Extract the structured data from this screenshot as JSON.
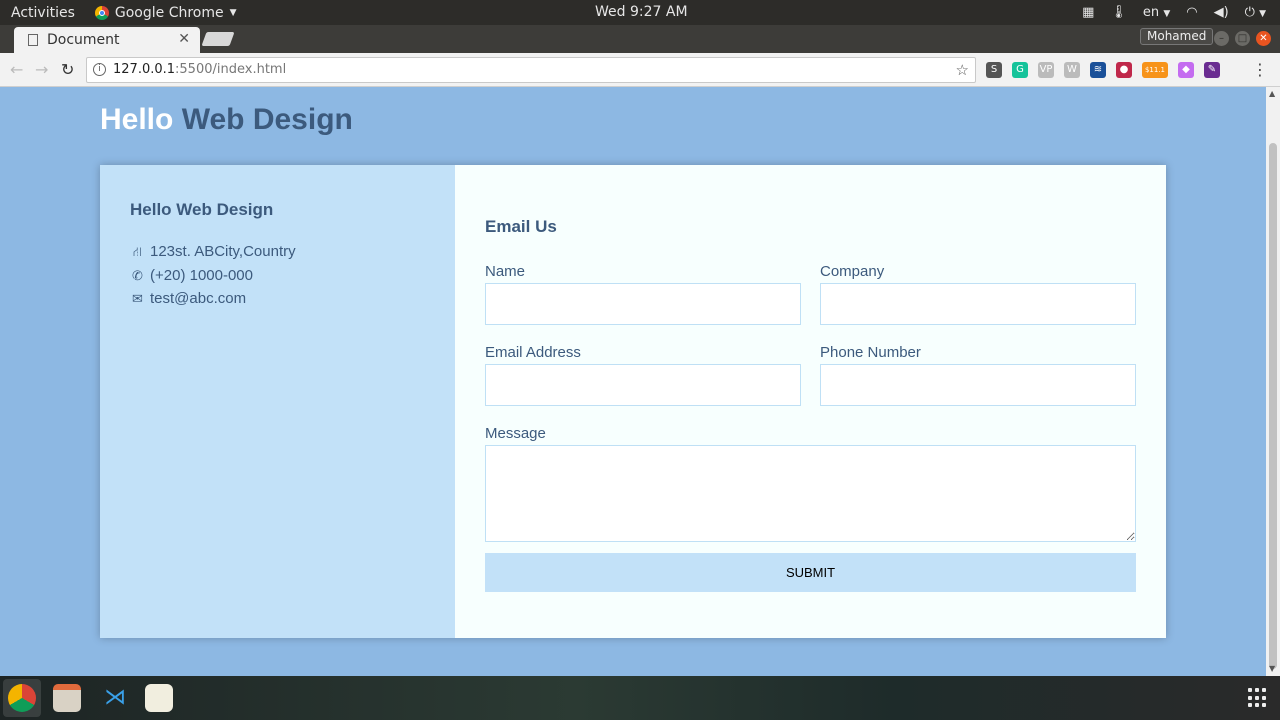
{
  "system": {
    "activities": "Activities",
    "app_menu": "Google Chrome",
    "clock": "Wed  9:27 AM",
    "language": "en"
  },
  "browser": {
    "tab_title": "Document",
    "profile_name": "Mohamed",
    "url_host": "127.0.0.1",
    "url_path": ":5500/index.html"
  },
  "extensions": [
    {
      "name": "s-extension-icon",
      "label": "S",
      "color": "#555555"
    },
    {
      "name": "grammarly-icon",
      "label": "G",
      "color": "#15c39a"
    },
    {
      "name": "vp-extension-icon",
      "label": "VP",
      "color": "#bbbbbb"
    },
    {
      "name": "wordpress-icon",
      "label": "W",
      "color": "#bbbbbb"
    },
    {
      "name": "steem-icon",
      "label": "≋",
      "color": "#1a5099"
    },
    {
      "name": "colorful-circle-icon",
      "label": "●",
      "color": "#c0284b"
    },
    {
      "name": "bitcoin-price-icon",
      "label": "$11.1",
      "color": "#f7931a"
    },
    {
      "name": "paint-extension-icon",
      "label": "◆",
      "color": "#c46cf0"
    },
    {
      "name": "eyedropper-icon",
      "label": "✎",
      "color": "#6a2c91"
    }
  ],
  "page": {
    "title_word1": "Hello",
    "title_word2": "Web Design",
    "contact": {
      "heading": "Hello Web Design",
      "address": "123st. ABCity,Country",
      "phone": "(+20) 1000-000",
      "email": "test@abc.com"
    },
    "form": {
      "heading": "Email Us",
      "name_label": "Name",
      "company_label": "Company",
      "email_label": "Email Address",
      "phone_label": "Phone Number",
      "message_label": "Message",
      "submit_label": "SUBMIT"
    }
  },
  "colors": {
    "page_background": "#8db8e3",
    "title_accent": "#3c5a7d",
    "panel_left": "#c2e1f8",
    "panel_right": "#f7fffe",
    "ubuntu_orange": "#e95420"
  }
}
